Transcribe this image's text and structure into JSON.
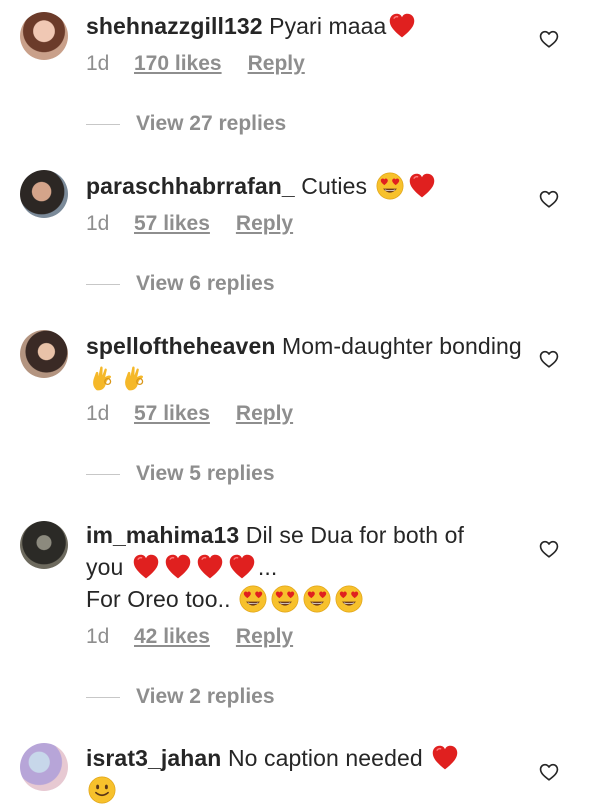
{
  "comments": [
    {
      "username": "shehnazzgill132",
      "text": "Pyari maaa",
      "emojis": [
        "red-heart"
      ],
      "time": "1d",
      "likes": "170 likes",
      "reply": "Reply",
      "view_replies": "View 27 replies"
    },
    {
      "username": "paraschhabrrafan_",
      "text": "Cuties",
      "emojis": [
        "heart-eyes",
        "red-heart"
      ],
      "time": "1d",
      "likes": "57 likes",
      "reply": "Reply",
      "view_replies": "View 6 replies"
    },
    {
      "username": "spelloftheheaven",
      "text": "Mom-daughter bonding",
      "emojis": [
        "ok-hand",
        "ok-hand"
      ],
      "time": "1d",
      "likes": "57 likes",
      "reply": "Reply",
      "view_replies": "View 5 replies"
    },
    {
      "username": "im_mahima13",
      "text_line1": "Dil se Dua for both of",
      "text_line2_prefix": "you",
      "text_line2_suffix": "...",
      "text_line3": "For Oreo too..",
      "emojis": [
        "red-heart",
        "red-heart",
        "red-heart",
        "red-heart",
        "heart-eyes",
        "heart-eyes",
        "heart-eyes",
        "heart-eyes"
      ],
      "time": "1d",
      "likes": "42 likes",
      "reply": "Reply",
      "view_replies": "View 2 replies"
    },
    {
      "username": "israt3_jahan",
      "text": "No caption needed",
      "emojis": [
        "red-heart",
        "slight-smile"
      ]
    }
  ],
  "colors": {
    "primary_text": "#262626",
    "secondary_text": "#8e8e8e",
    "divider": "#c7c7c7",
    "heart_emoji": "#e0201f"
  },
  "icons": {
    "like": "heart-outline-icon"
  }
}
